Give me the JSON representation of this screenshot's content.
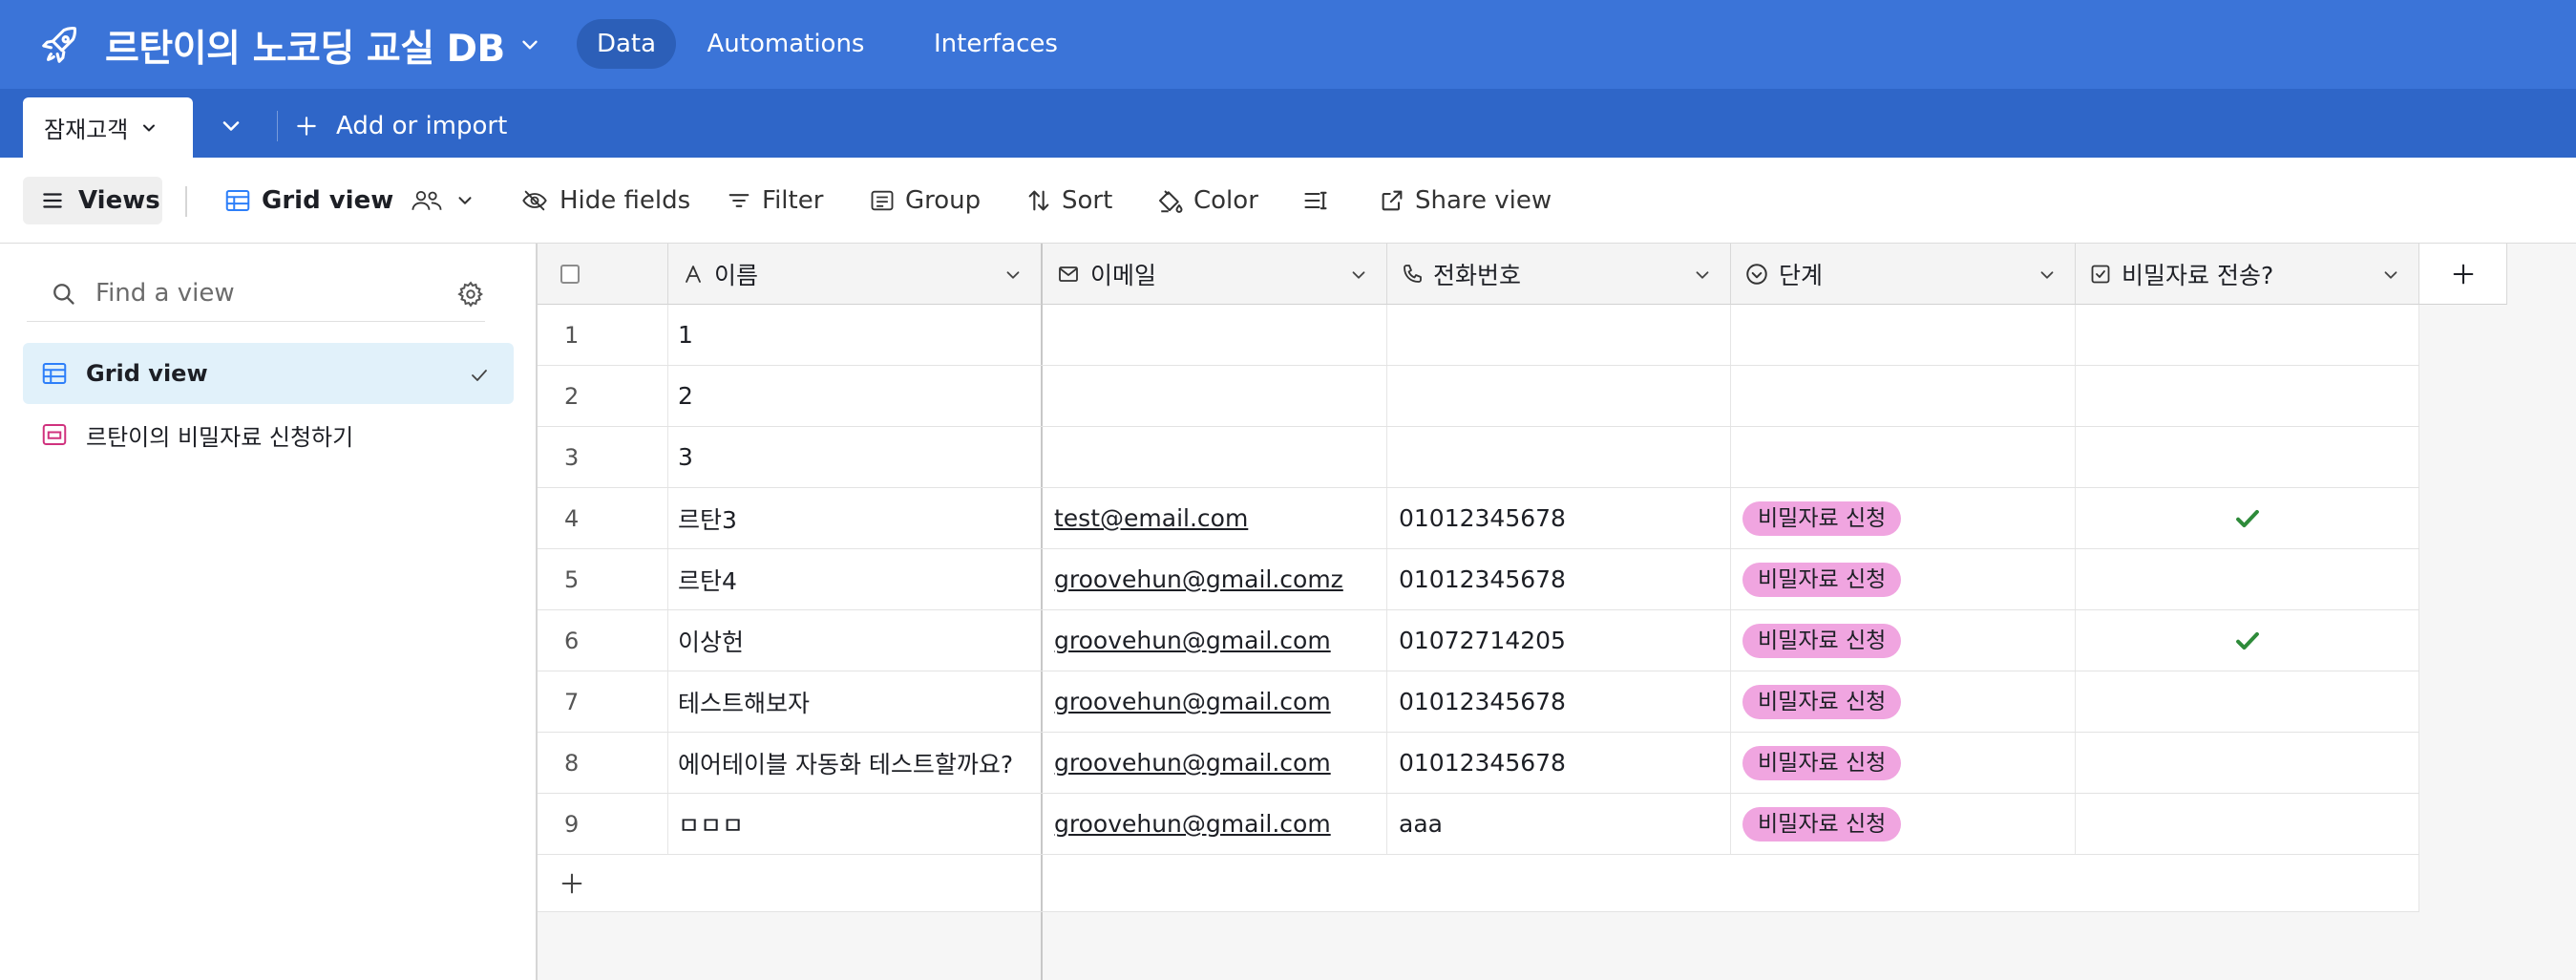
{
  "app": {
    "base_title": "르탄이의 노코딩 교실 DB",
    "nav": {
      "data": "Data",
      "automations": "Automations",
      "interfaces": "Interfaces"
    },
    "accent": "#3b74d8"
  },
  "tabs": {
    "active_table": "잠재고객",
    "add_import": "Add or import"
  },
  "toolbar": {
    "views": "Views",
    "grid_view": "Grid view",
    "hide_fields": "Hide fields",
    "filter": "Filter",
    "group": "Group",
    "sort": "Sort",
    "color": "Color",
    "share_view": "Share view"
  },
  "sidebar": {
    "search_placeholder": "Find a view",
    "items": [
      {
        "label": "Grid view",
        "icon": "grid-icon",
        "selected": true
      },
      {
        "label": "르탄이의 비밀자료 신청하기",
        "icon": "form-icon",
        "selected": false
      }
    ]
  },
  "grid": {
    "columns": [
      {
        "label": "이름",
        "icon": "text-field-icon"
      },
      {
        "label": "이메일",
        "icon": "email-field-icon"
      },
      {
        "label": "전화번호",
        "icon": "phone-field-icon"
      },
      {
        "label": "단계",
        "icon": "single-select-icon"
      },
      {
        "label": "비밀자료 전송?",
        "icon": "checkbox-field-icon"
      }
    ],
    "rows": [
      {
        "num": "1",
        "name": "1",
        "email": "",
        "phone": "",
        "stage": "",
        "sent": false
      },
      {
        "num": "2",
        "name": "2",
        "email": "",
        "phone": "",
        "stage": "",
        "sent": false
      },
      {
        "num": "3",
        "name": "3",
        "email": "",
        "phone": "",
        "stage": "",
        "sent": false
      },
      {
        "num": "4",
        "name": "르탄3",
        "email": "test@email.com",
        "phone": "01012345678",
        "stage": "비밀자료 신청",
        "sent": true
      },
      {
        "num": "5",
        "name": "르탄4",
        "email": "groovehun@gmail.comz",
        "phone": "01012345678",
        "stage": "비밀자료 신청",
        "sent": false
      },
      {
        "num": "6",
        "name": "이상헌",
        "email": "groovehun@gmail.com",
        "phone": "01072714205",
        "stage": "비밀자료 신청",
        "sent": true
      },
      {
        "num": "7",
        "name": "테스트해보자",
        "email": "groovehun@gmail.com",
        "phone": "01012345678",
        "stage": "비밀자료 신청",
        "sent": false
      },
      {
        "num": "8",
        "name": "에어테이블 자동화 테스트할까요?",
        "email": "groovehun@gmail.com",
        "phone": "01012345678",
        "stage": "비밀자료 신청",
        "sent": false
      },
      {
        "num": "9",
        "name": "ㅁㅁㅁ",
        "email": "groovehun@gmail.com",
        "phone": "aaa",
        "stage": "비밀자료 신청",
        "sent": false
      }
    ],
    "stage_color": "#f0a5e0",
    "check_color": "#2e8b3a"
  }
}
